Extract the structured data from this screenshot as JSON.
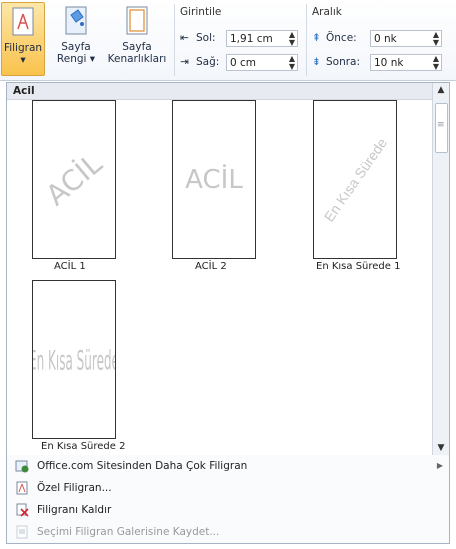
{
  "ribbon": {
    "buttons": [
      {
        "label": "Filigran",
        "sub": "▾"
      },
      {
        "label": "Sayfa",
        "sub": "Rengi ▾"
      },
      {
        "label": "Sayfa",
        "sub": "Kenarlıkları"
      }
    ],
    "indent": {
      "title": "Girintile",
      "left_label": "Sol:",
      "left_value": "1,91 cm",
      "right_label": "Sağ:",
      "right_value": "0 cm"
    },
    "spacing": {
      "title": "Aralık",
      "before_label": "Önce:",
      "before_value": "0 nk",
      "after_label": "Sonra:",
      "after_value": "10 nk"
    }
  },
  "gallery": {
    "category": "Acil",
    "items": [
      {
        "caption": "ACİL 1",
        "watermark": "ACİL"
      },
      {
        "caption": "ACİL 2",
        "watermark": "ACİL"
      },
      {
        "caption": "En Kısa Sürede 1",
        "watermark": "En Kısa Sürede"
      },
      {
        "caption": "En Kısa Sürede 2",
        "watermark": "En Kısa Sürede"
      }
    ]
  },
  "menu": {
    "items": [
      {
        "label": "Office.com Sitesinden Daha Çok Filigran",
        "enabled": true
      },
      {
        "label": "Özel Filigran...",
        "enabled": true
      },
      {
        "label": "Filigranı Kaldır",
        "enabled": true
      },
      {
        "label": "Seçimi Filigran Galerisine Kaydet...",
        "enabled": false
      }
    ]
  },
  "colors": {
    "active_button": "#f9c24c",
    "accent": "#2f6fc4"
  }
}
